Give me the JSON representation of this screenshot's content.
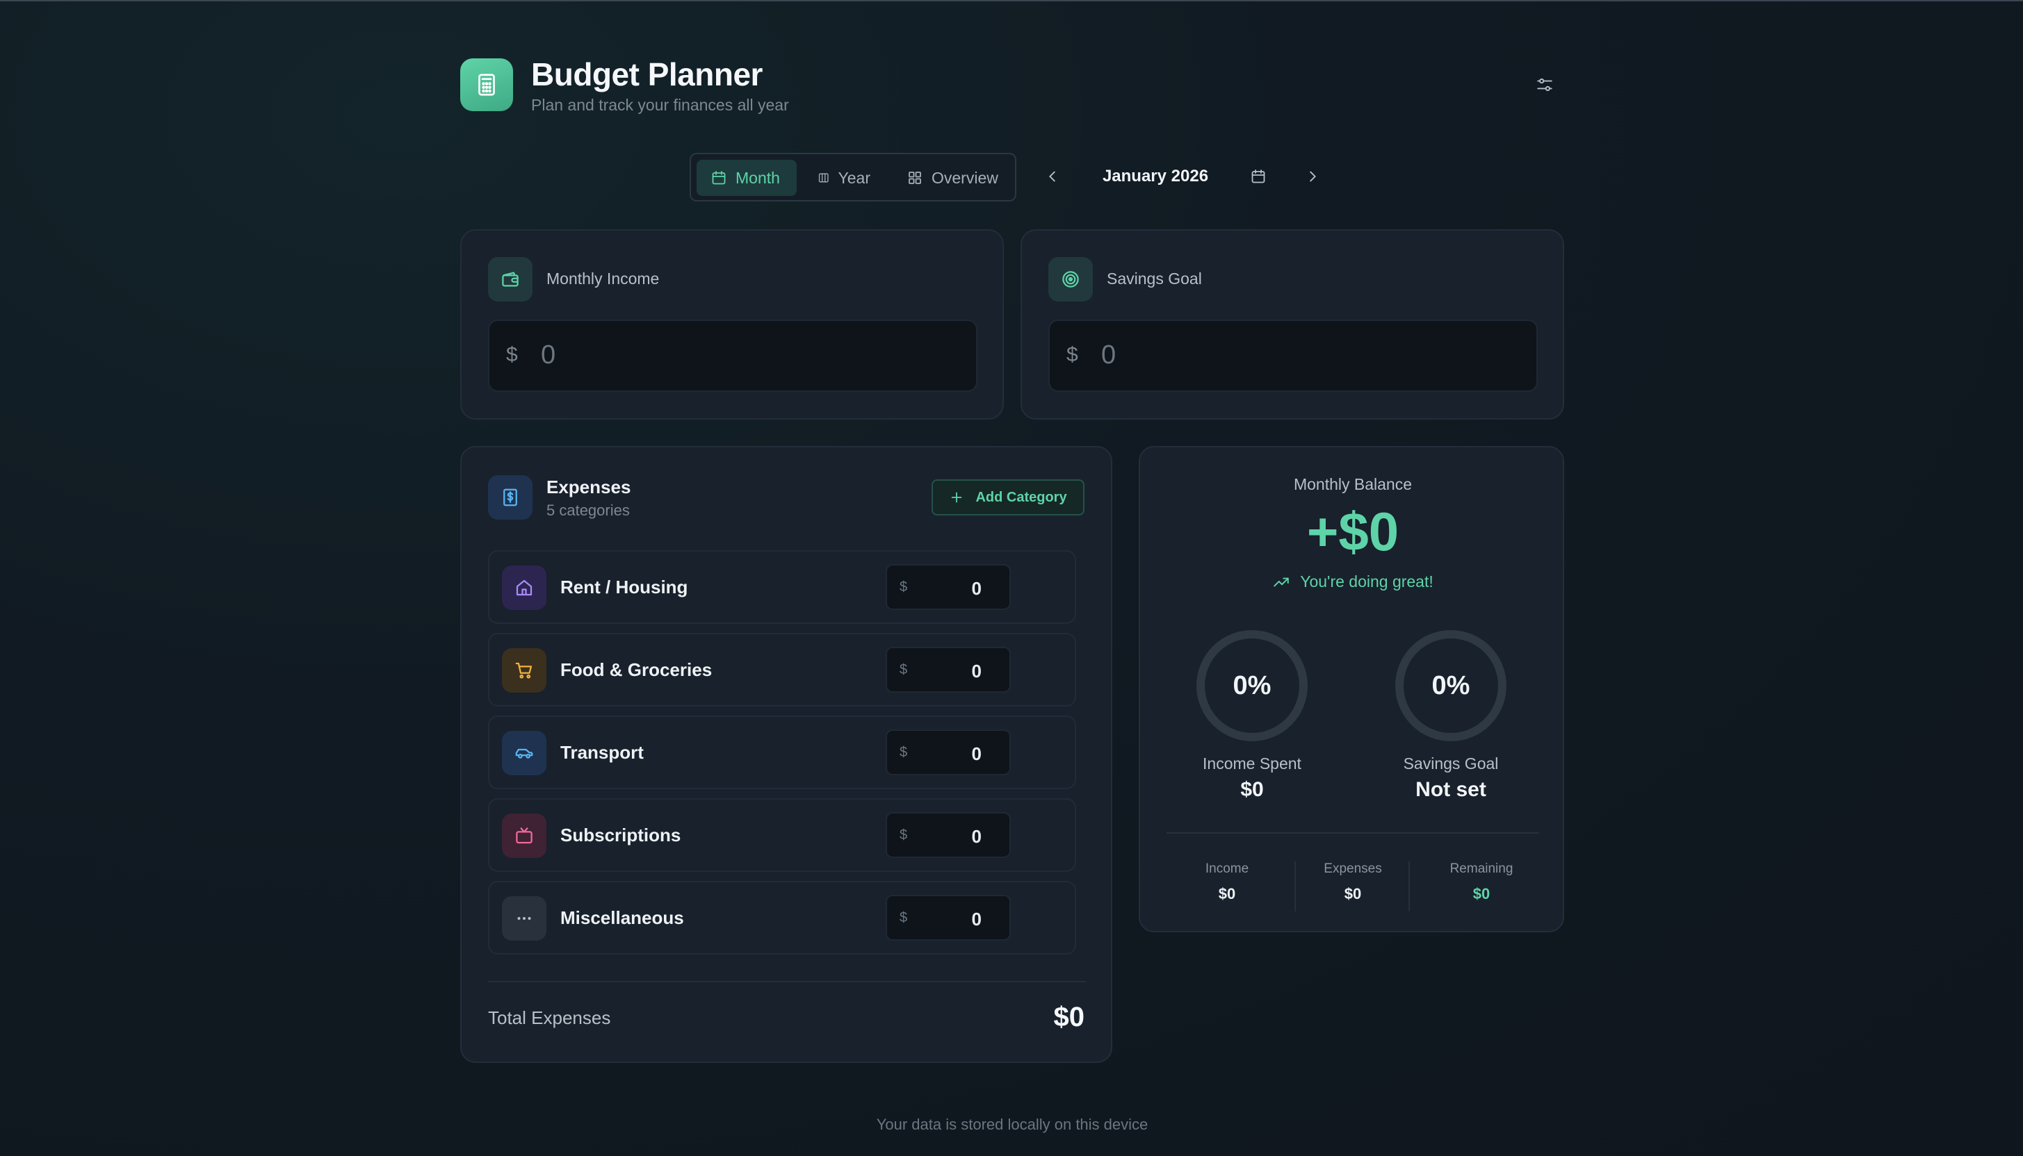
{
  "header": {
    "title": "Budget Planner",
    "subtitle": "Plan and track your finances all year",
    "app_icon": "calculator-icon",
    "settings_icon": "sliders-icon"
  },
  "view_tabs": [
    {
      "label": "Month",
      "icon": "calendar-icon",
      "active": true
    },
    {
      "label": "Year",
      "icon": "columns-icon",
      "active": false
    },
    {
      "label": "Overview",
      "icon": "grid-icon",
      "active": false
    }
  ],
  "date_nav": {
    "current": "January 2026"
  },
  "income": {
    "label": "Monthly Income",
    "currency": "$",
    "placeholder": "0",
    "icon": "wallet-icon"
  },
  "savings": {
    "label": "Savings Goal",
    "currency": "$",
    "placeholder": "0",
    "icon": "target-icon"
  },
  "expenses": {
    "title": "Expenses",
    "subtitle": "5 categories",
    "add_label": "Add Category",
    "categories": [
      {
        "name": "Rent / Housing",
        "currency": "$",
        "value": "0",
        "icon": "home-icon",
        "color": "#a98bff"
      },
      {
        "name": "Food & Groceries",
        "currency": "$",
        "value": "0",
        "icon": "cart-icon",
        "color": "#f2b33d"
      },
      {
        "name": "Transport",
        "currency": "$",
        "value": "0",
        "icon": "car-icon",
        "color": "#5ab4f2"
      },
      {
        "name": "Subscriptions",
        "currency": "$",
        "value": "0",
        "icon": "tv-icon",
        "color": "#f06b9b"
      },
      {
        "name": "Miscellaneous",
        "currency": "$",
        "value": "0",
        "icon": "more-icon",
        "color": "#9aa4ae"
      }
    ],
    "total_label": "Total Expenses",
    "total_value": "$0"
  },
  "balance": {
    "label": "Monthly Balance",
    "value": "+$0",
    "message": "You're doing great!",
    "income_spent": {
      "percent": "0%",
      "label": "Income Spent",
      "value": "$0"
    },
    "savings_goal": {
      "percent": "0%",
      "label": "Savings Goal",
      "value": "Not set"
    },
    "stats": [
      {
        "label": "Income",
        "value": "$0"
      },
      {
        "label": "Expenses",
        "value": "$0"
      },
      {
        "label": "Remaining",
        "value": "$0"
      }
    ]
  },
  "footer": "Your data is stored locally on this device",
  "colors": {
    "accent": "#5fd3a8",
    "card": "#18212c",
    "background": "#111a22"
  }
}
